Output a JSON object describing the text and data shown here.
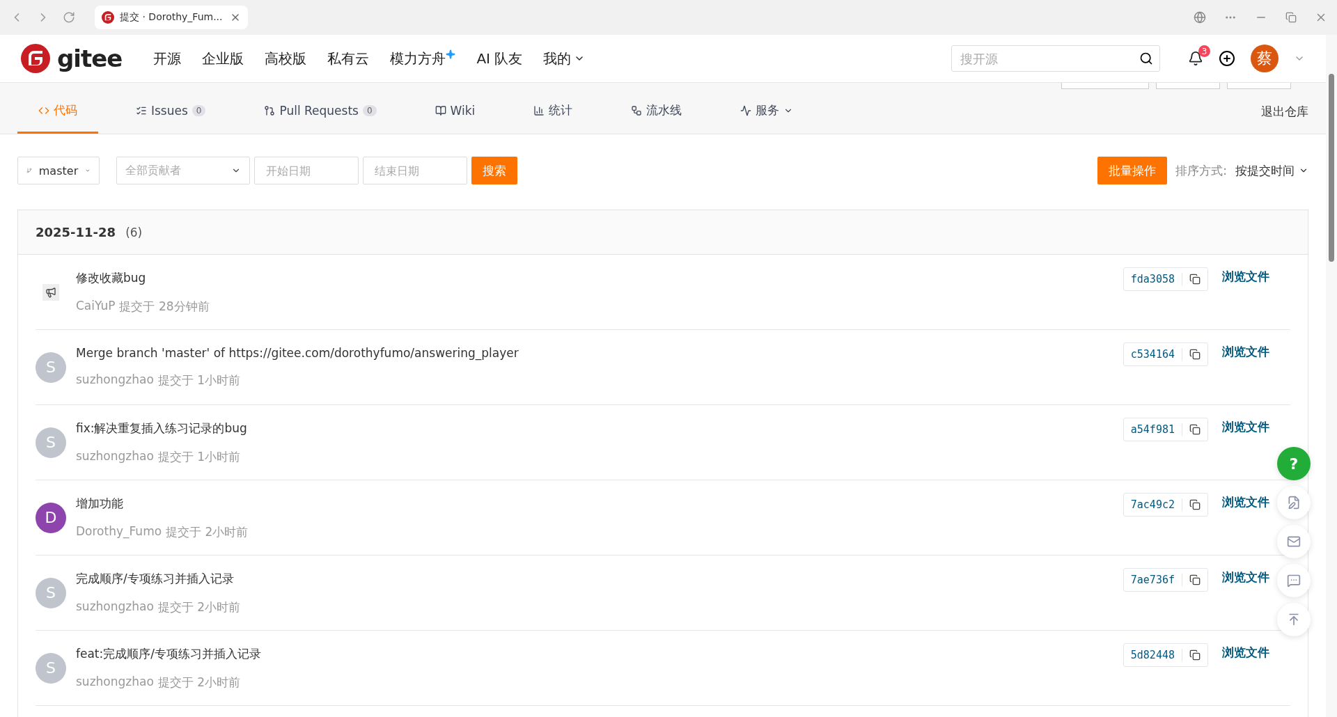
{
  "browser": {
    "tab_title": "提交 · Dorothy_Fum..."
  },
  "header": {
    "logo_text": "gitee",
    "nav": [
      {
        "label": "开源",
        "kind": "plain"
      },
      {
        "label": "企业版",
        "kind": "plain"
      },
      {
        "label": "高校版",
        "kind": "plain"
      },
      {
        "label": "私有云",
        "kind": "plain"
      },
      {
        "label": "模力方舟",
        "kind": "new"
      },
      {
        "label": "AI 队友",
        "kind": "plain"
      },
      {
        "label": "我的",
        "kind": "menu"
      }
    ],
    "search": {
      "placeholder": "搜开源"
    },
    "notification_count": "3",
    "avatar": "蔡"
  },
  "tabs": [
    {
      "label": "代码",
      "kind": "plain",
      "selected": true
    },
    {
      "label": "Issues",
      "kind": "plain",
      "count": "0",
      "selected": false
    },
    {
      "label": "Pull Requests",
      "kind": "plain",
      "count": "0",
      "selected": false
    },
    {
      "label": "Wiki",
      "kind": "plain",
      "selected": false
    },
    {
      "label": "统计",
      "kind": "plain",
      "selected": false
    },
    {
      "label": "流水线",
      "kind": "plain",
      "selected": false
    },
    {
      "label": "服务",
      "kind": "menu",
      "selected": false
    }
  ],
  "exit_repo": "退出仓库",
  "filters": {
    "branch": "master",
    "contributor": "全部贡献者",
    "start_date": {
      "placeholder": "开始日期"
    },
    "end_date": {
      "placeholder": "结束日期"
    },
    "search_button": "搜索",
    "batch_button": "批量操作",
    "sort_label": "排序方式:",
    "sort_value": "按提交时间"
  },
  "group": {
    "date": "2025-11-28",
    "count": "(6)",
    "commits": [
      {
        "message": "修改收藏bug",
        "author": "CaiYuP",
        "time": "提交于 28分钟前",
        "hash": "fda3058",
        "browse": "浏览文件",
        "avatar": {
          "kind": "image"
        }
      },
      {
        "message": "Merge branch 'master' of https://gitee.com/dorothyfumo/answering_player",
        "author": "suzhongzhao",
        "time": "提交于 1小时前",
        "hash": "c534164",
        "browse": "浏览文件",
        "avatar": {
          "kind": "letter",
          "letter": "S",
          "color": "#c0c4cc"
        }
      },
      {
        "message": "fix:解决重复插入练习记录的bug",
        "author": "suzhongzhao",
        "time": "提交于 1小时前",
        "hash": "a54f981",
        "browse": "浏览文件",
        "avatar": {
          "kind": "letter",
          "letter": "S",
          "color": "#c0c4cc"
        }
      },
      {
        "message": "增加功能",
        "author": "Dorothy_Fumo",
        "time": "提交于 2小时前",
        "hash": "7ac49c2",
        "browse": "浏览文件",
        "avatar": {
          "kind": "letter",
          "letter": "D",
          "color": "#8e44ad"
        }
      },
      {
        "message": "完成顺序/专项练习并插入记录",
        "author": "suzhongzhao",
        "time": "提交于 2小时前",
        "hash": "7ae736f",
        "browse": "浏览文件",
        "avatar": {
          "kind": "letter",
          "letter": "S",
          "color": "#c0c4cc"
        }
      },
      {
        "message": "feat:完成顺序/专项练习并插入记录",
        "author": "suzhongzhao",
        "time": "提交于 2小时前",
        "hash": "5d82448",
        "browse": "浏览文件",
        "avatar": {
          "kind": "letter",
          "letter": "S",
          "color": "#c0c4cc"
        }
      }
    ]
  },
  "float_help": "?"
}
